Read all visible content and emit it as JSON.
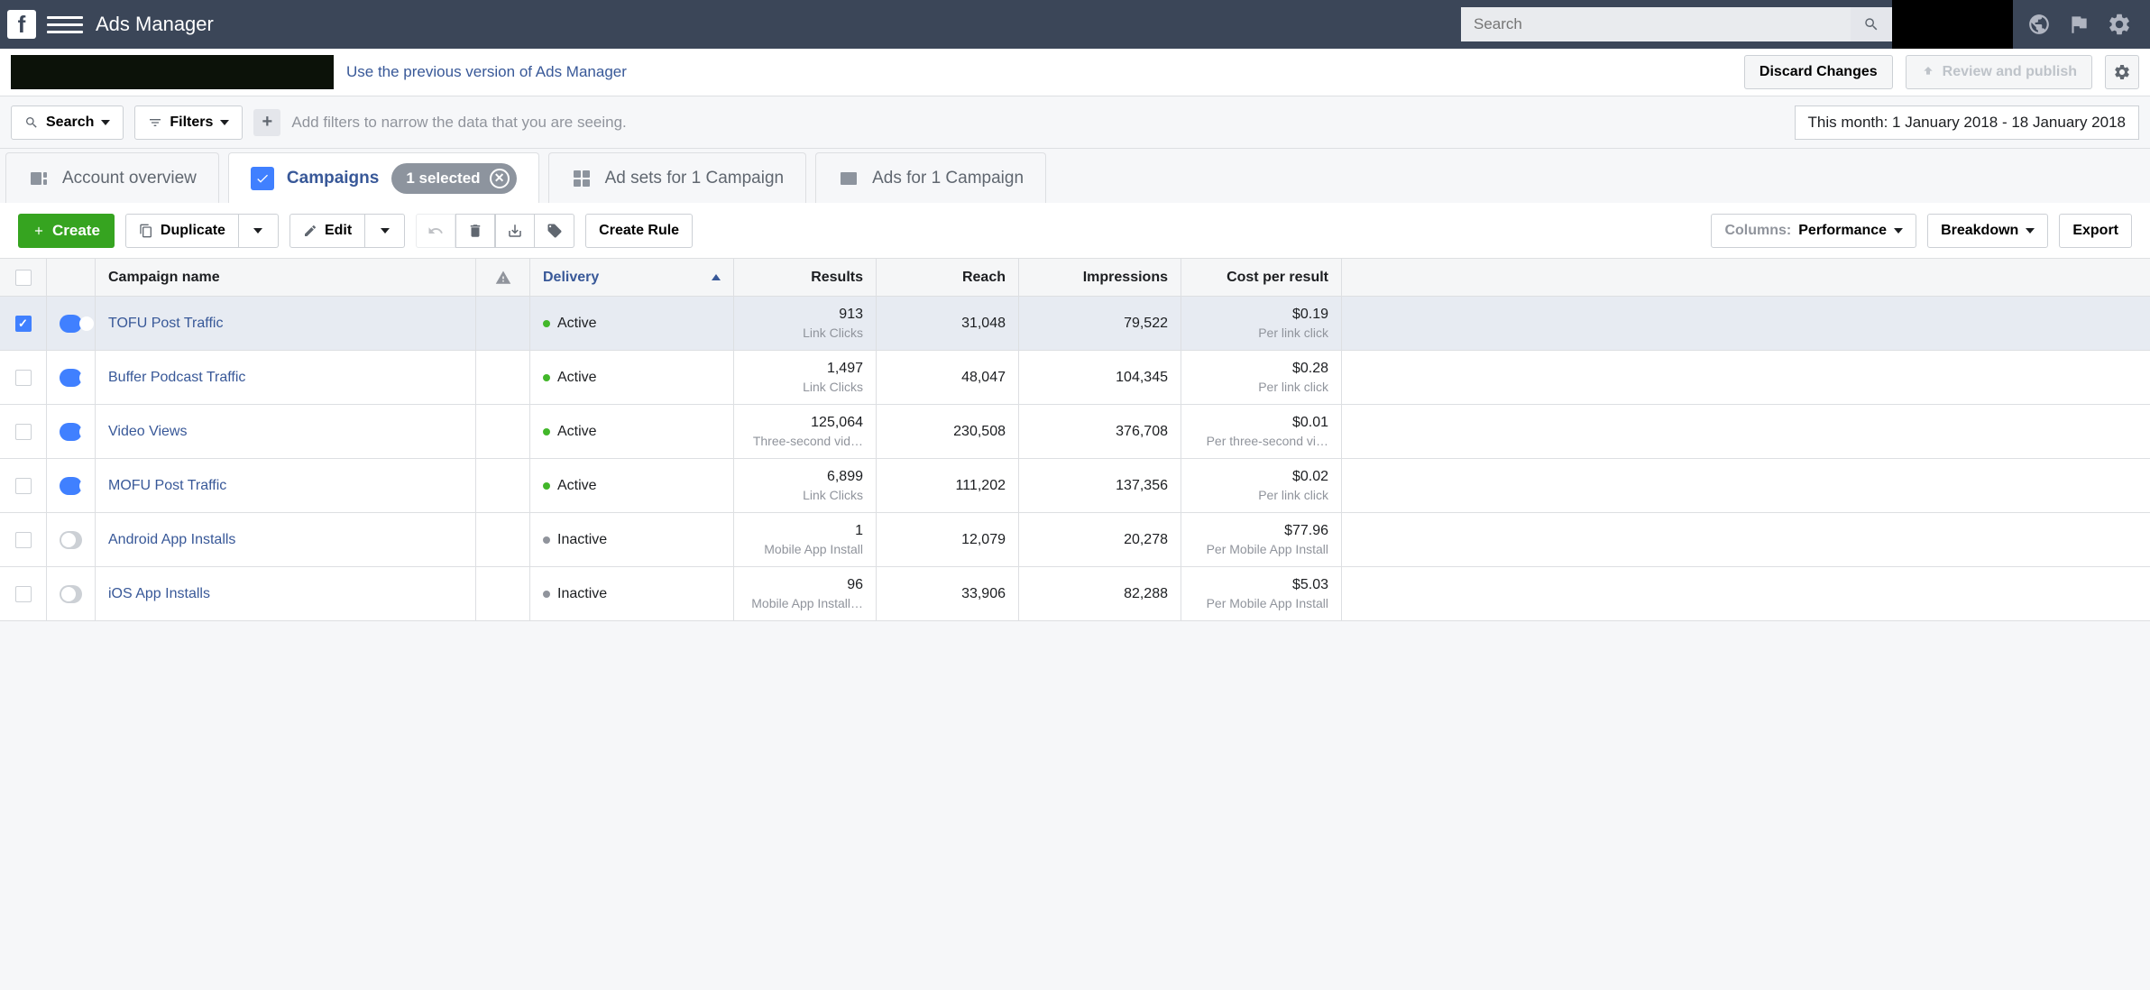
{
  "header": {
    "app_title": "Ads Manager",
    "search_placeholder": "Search"
  },
  "secondbar": {
    "prev_version_link": "Use the previous version of Ads Manager",
    "discard": "Discard Changes",
    "review": "Review and publish"
  },
  "filterbar": {
    "search": "Search",
    "filters": "Filters",
    "placeholder": "Add filters to narrow the data that you are seeing.",
    "date_range": "This month: 1 January 2018 - 18 January 2018"
  },
  "tabs": {
    "overview": "Account overview",
    "campaigns": "Campaigns",
    "selected_count": "1 selected",
    "adsets": "Ad sets for 1 Campaign",
    "ads": "Ads for 1 Campaign"
  },
  "toolbar": {
    "create": "Create",
    "duplicate": "Duplicate",
    "edit": "Edit",
    "create_rule": "Create Rule",
    "columns_label": "Columns:",
    "columns_value": "Performance",
    "breakdown": "Breakdown",
    "export": "Export"
  },
  "table": {
    "headers": {
      "name": "Campaign name",
      "delivery": "Delivery",
      "results": "Results",
      "reach": "Reach",
      "impressions": "Impressions",
      "cost": "Cost per result"
    },
    "rows": [
      {
        "selected": true,
        "enabled": true,
        "name": "TOFU Post Traffic",
        "delivery": "Active",
        "delivery_status": "active",
        "results": "913",
        "results_label": "Link Clicks",
        "reach": "31,048",
        "impressions": "79,522",
        "cost": "$0.19",
        "cost_label": "Per link click"
      },
      {
        "selected": false,
        "enabled": true,
        "name": "Buffer Podcast Traffic",
        "delivery": "Active",
        "delivery_status": "active",
        "results": "1,497",
        "results_label": "Link Clicks",
        "reach": "48,047",
        "impressions": "104,345",
        "cost": "$0.28",
        "cost_label": "Per link click"
      },
      {
        "selected": false,
        "enabled": true,
        "name": "Video Views",
        "delivery": "Active",
        "delivery_status": "active",
        "results": "125,064",
        "results_label": "Three-second vid…",
        "reach": "230,508",
        "impressions": "376,708",
        "cost": "$0.01",
        "cost_label": "Per three-second vi…"
      },
      {
        "selected": false,
        "enabled": true,
        "name": "MOFU Post Traffic",
        "delivery": "Active",
        "delivery_status": "active",
        "results": "6,899",
        "results_label": "Link Clicks",
        "reach": "111,202",
        "impressions": "137,356",
        "cost": "$0.02",
        "cost_label": "Per link click"
      },
      {
        "selected": false,
        "enabled": false,
        "name": "Android App Installs",
        "delivery": "Inactive",
        "delivery_status": "inactive",
        "results": "1",
        "results_label": "Mobile App Install",
        "reach": "12,079",
        "impressions": "20,278",
        "cost": "$77.96",
        "cost_label": "Per Mobile App Install"
      },
      {
        "selected": false,
        "enabled": false,
        "name": "iOS App Installs",
        "delivery": "Inactive",
        "delivery_status": "inactive",
        "results": "96",
        "results_label": "Mobile App Install…",
        "reach": "33,906",
        "impressions": "82,288",
        "cost": "$5.03",
        "cost_label": "Per Mobile App Install"
      }
    ]
  }
}
